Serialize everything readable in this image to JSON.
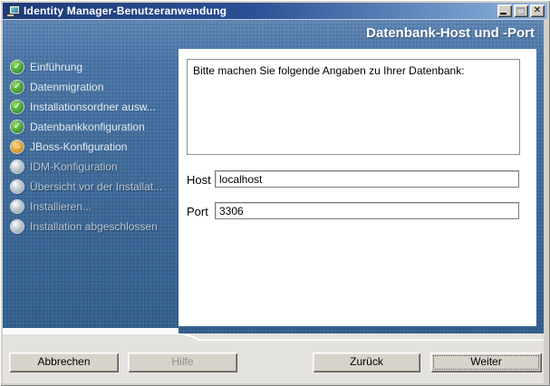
{
  "window": {
    "title": "Identity Manager-Benutzeranwendung"
  },
  "header": {
    "title": "Datenbank-Host und -Port"
  },
  "sidebar": {
    "items": [
      {
        "label": "Einführung",
        "status": "done"
      },
      {
        "label": "Datenmigration",
        "status": "done"
      },
      {
        "label": "Installationsordner ausw...",
        "status": "done"
      },
      {
        "label": "Datenbankkonfiguration",
        "status": "done"
      },
      {
        "label": "JBoss-Konfiguration",
        "status": "current"
      },
      {
        "label": "IDM-Konfiguration",
        "status": "pending"
      },
      {
        "label": "Übersicht vor der Installat...",
        "status": "pending"
      },
      {
        "label": "Installieren...",
        "status": "pending"
      },
      {
        "label": "Installation abgeschlossen",
        "status": "pending"
      }
    ]
  },
  "main": {
    "instruction": "Bitte machen Sie folgende Angaben zu Ihrer Datenbank:",
    "fields": {
      "host": {
        "label": "Host",
        "value": "localhost"
      },
      "port": {
        "label": "Port",
        "value": "3306"
      }
    }
  },
  "footer": {
    "cancel_label": "Abbrechen",
    "help_label": "Hilfe",
    "back_label": "Zurück",
    "next_label": "Weiter"
  },
  "icons": {
    "done_glyph": "✓",
    "current_glyph": "→",
    "close_glyph": "✕"
  },
  "colors": {
    "titlebar_left": "#1d3a78",
    "titlebar_right": "#8fb5de",
    "panel_blue": "#416d9c",
    "frame_blue": "#33608e",
    "step_done_green": "#4aa337",
    "step_current_amber": "#e0a02e",
    "footer_gray": "#e4e2de"
  }
}
